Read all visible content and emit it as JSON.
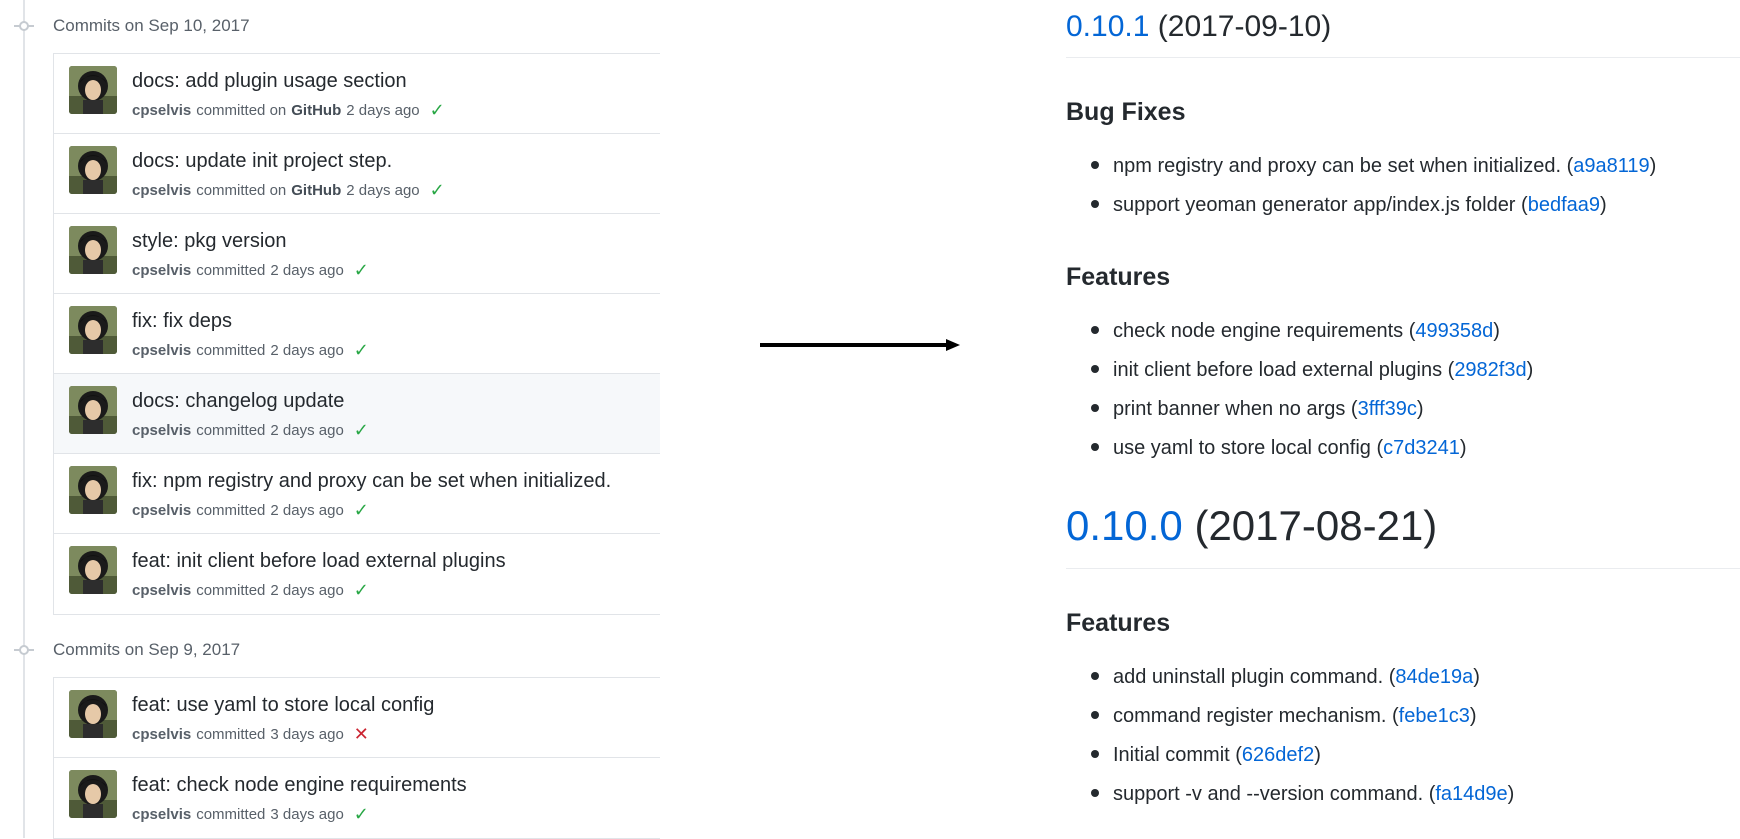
{
  "commit_groups": [
    {
      "title": "Commits on Sep 10, 2017",
      "commits": [
        {
          "message": "docs: add plugin usage section",
          "author": "cpselvis",
          "verb": "committed on",
          "via": "GitHub",
          "time": "2 days ago",
          "status": "success"
        },
        {
          "message": "docs: update init project step.",
          "author": "cpselvis",
          "verb": "committed on",
          "via": "GitHub",
          "time": "2 days ago",
          "status": "success"
        },
        {
          "message": "style: pkg version",
          "author": "cpselvis",
          "verb": "committed",
          "via": "",
          "time": "2 days ago",
          "status": "success"
        },
        {
          "message": "fix: fix deps",
          "author": "cpselvis",
          "verb": "committed",
          "via": "",
          "time": "2 days ago",
          "status": "success"
        },
        {
          "message": "docs: changelog update",
          "author": "cpselvis",
          "verb": "committed",
          "via": "",
          "time": "2 days ago",
          "status": "success"
        },
        {
          "message": "fix: npm registry and proxy can be set when initialized.",
          "author": "cpselvis",
          "verb": "committed",
          "via": "",
          "time": "2 days ago",
          "status": "success"
        },
        {
          "message": "feat: init client before load external plugins",
          "author": "cpselvis",
          "verb": "committed",
          "via": "",
          "time": "2 days ago",
          "status": "success"
        }
      ]
    },
    {
      "title": "Commits on Sep 9, 2017",
      "commits": [
        {
          "message": "feat: use yaml to store local config",
          "author": "cpselvis",
          "verb": "committed",
          "via": "",
          "time": "3 days ago",
          "status": "failure"
        },
        {
          "message": "feat: check node engine requirements",
          "author": "cpselvis",
          "verb": "committed",
          "via": "",
          "time": "3 days ago",
          "status": "success"
        }
      ]
    }
  ],
  "status_icons": {
    "success": "check-icon",
    "failure": "x-icon"
  },
  "colors": {
    "success": "#28a745",
    "failure": "#cb2431",
    "link": "#0366d6"
  },
  "changelog": {
    "releases": [
      {
        "version": "0.10.1",
        "date": "(2017-09-10)",
        "sections": [
          {
            "title": "Bug Fixes",
            "items": [
              {
                "text": "npm registry and proxy can be set when initialized.",
                "hash": "a9a8119"
              },
              {
                "text": "support yeoman generator app/index.js folder",
                "hash": "bedfaa9"
              }
            ]
          },
          {
            "title": "Features",
            "items": [
              {
                "text": "check node engine requirements",
                "hash": "499358d"
              },
              {
                "text": "init client before load external plugins",
                "hash": "2982f3d"
              },
              {
                "text": "print banner when no args",
                "hash": "3fff39c"
              },
              {
                "text": "use yaml to store local config",
                "hash": "c7d3241"
              }
            ]
          }
        ]
      },
      {
        "version": "0.10.0",
        "date": "(2017-08-21)",
        "sections": [
          {
            "title": "Features",
            "items": [
              {
                "text": "add uninstall plugin command.",
                "hash": "84de19a"
              },
              {
                "text": "command register mechanism.",
                "hash": "febe1c3"
              },
              {
                "text": "Initial commit",
                "hash": "626def2"
              },
              {
                "text": "support -v and --version command.",
                "hash": "fa14d9e"
              }
            ]
          }
        ]
      }
    ]
  }
}
